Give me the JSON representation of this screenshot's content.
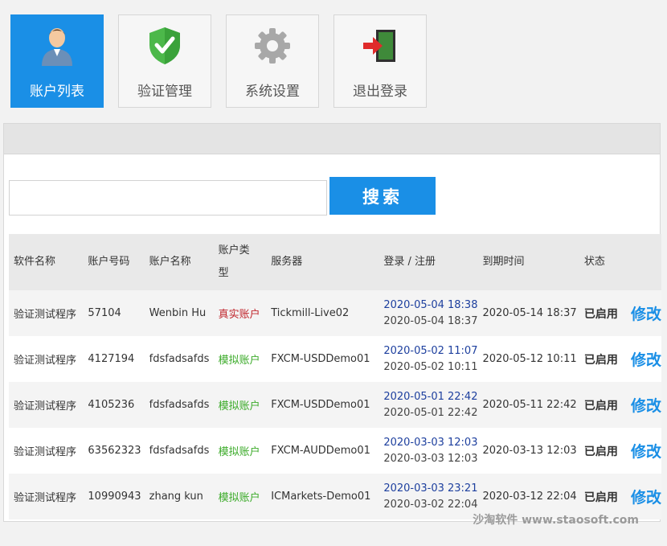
{
  "nav": [
    {
      "label": "账户列表",
      "icon": "user-icon",
      "active": true
    },
    {
      "label": "验证管理",
      "icon": "shield-check-icon",
      "active": false
    },
    {
      "label": "系统设置",
      "icon": "gear-icon",
      "active": false
    },
    {
      "label": "退出登录",
      "icon": "logout-door-icon",
      "active": false
    }
  ],
  "search": {
    "placeholder": "",
    "value": "",
    "button_label": "搜索"
  },
  "table": {
    "headers": {
      "software": "软件名称",
      "account_no": "账户号码",
      "account_name": "账户名称",
      "account_type_1": "账户类",
      "account_type_2": "型",
      "server": "服务器",
      "login_reg": "登录 / 注册",
      "expiry": "到期时间",
      "status": "状态"
    },
    "rows": [
      {
        "software": "验证测试程序",
        "account_no": "57104",
        "account_name": "Wenbin Hu",
        "account_type": "真实账户",
        "type_kind": "real",
        "server": "Tickmill-Live02",
        "login": "2020-05-04 18:38",
        "register": "2020-05-04 18:37",
        "expiry": "2020-05-14 18:37",
        "status": "已启用",
        "action": "修改"
      },
      {
        "software": "验证测试程序",
        "account_no": "4127194",
        "account_name": "fdsfadsafds",
        "account_type": "模拟账户",
        "type_kind": "sim",
        "server": "FXCM-USDDemo01",
        "login": "2020-05-02 11:07",
        "register": "2020-05-02 10:11",
        "expiry": "2020-05-12 10:11",
        "status": "已启用",
        "action": "修改"
      },
      {
        "software": "验证测试程序",
        "account_no": "4105236",
        "account_name": "fdsfadsafds",
        "account_type": "模拟账户",
        "type_kind": "sim",
        "server": "FXCM-USDDemo01",
        "login": "2020-05-01 22:42",
        "register": "2020-05-01 22:42",
        "expiry": "2020-05-11 22:42",
        "status": "已启用",
        "action": "修改"
      },
      {
        "software": "验证测试程序",
        "account_no": "63562323",
        "account_name": "fdsfadsafds",
        "account_type": "模拟账户",
        "type_kind": "sim",
        "server": "FXCM-AUDDemo01",
        "login": "2020-03-03 12:03",
        "register": "2020-03-03 12:03",
        "expiry": "2020-03-13 12:03",
        "status": "已启用",
        "action": "修改"
      },
      {
        "software": "验证测试程序",
        "account_no": "10990943",
        "account_name": "zhang kun",
        "account_type": "模拟账户",
        "type_kind": "sim",
        "server": "ICMarkets-Demo01",
        "login": "2020-03-03 23:21",
        "register": "2020-03-02 22:04",
        "expiry": "2020-03-12 22:04",
        "status": "已启用",
        "action": "修改"
      }
    ]
  },
  "watermark": "沙淘软件 www.staosoft.com",
  "colors": {
    "accent": "#1a8fe6",
    "real": "#c0262d",
    "sim": "#3cab2a",
    "login": "#1d3f9e"
  }
}
